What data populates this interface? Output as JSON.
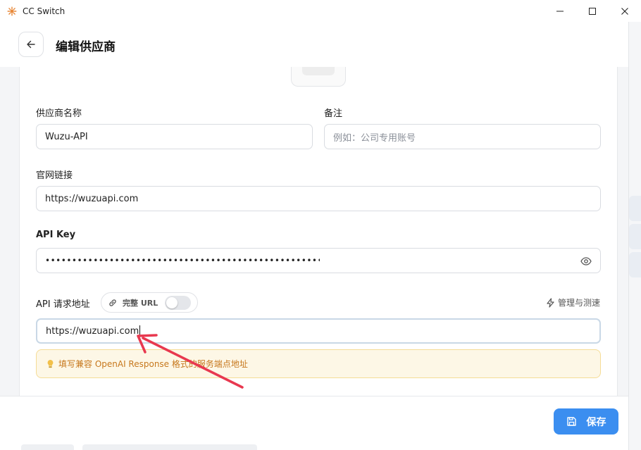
{
  "window": {
    "app_title": "CC Switch",
    "controls": [
      "minimize",
      "maximize",
      "close"
    ]
  },
  "header": {
    "title": "编辑供应商"
  },
  "form": {
    "provider_name": {
      "label": "供应商名称",
      "value": "Wuzu-API"
    },
    "notes": {
      "label": "备注",
      "placeholder": "例如：公司专用账号"
    },
    "website": {
      "label": "官网链接",
      "value": "https://wuzuapi.com"
    },
    "api_key": {
      "label": "API Key",
      "masked_value": "••••••••••••••••••••••••••••••••••••••••••••••••••••••••••••••••••••••"
    },
    "endpoint": {
      "label": "API 请求地址",
      "full_url_toggle_label": "完整 URL",
      "full_url_enabled": false,
      "manage_label": "管理与测速",
      "value": "https://wuzuapi.com",
      "hint": "填写兼容 OpenAI Response 格式的服务端点地址"
    }
  },
  "footer": {
    "save_label": "保存"
  },
  "colors": {
    "accent": "#3b8ef0",
    "hint_bg": "#fdf7e6",
    "hint_text": "#c7781d",
    "annotation_arrow": "#e8384f"
  }
}
